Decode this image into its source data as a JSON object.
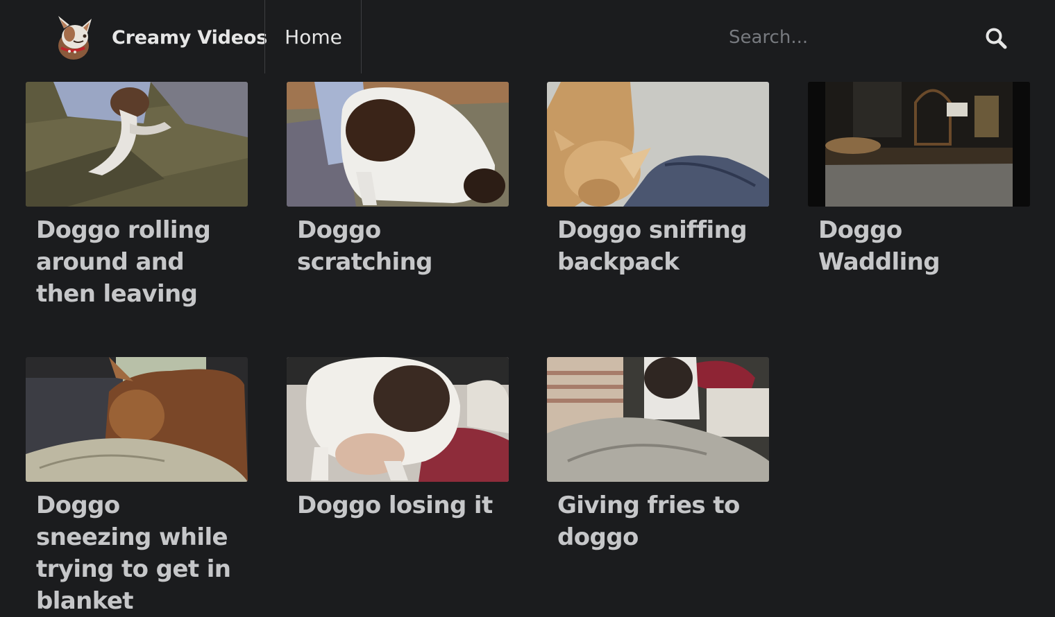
{
  "brand": {
    "name": "Creamy Videos"
  },
  "nav": {
    "home_label": "Home"
  },
  "search": {
    "placeholder": "Search..."
  },
  "videos": [
    {
      "title": "Doggo rolling around and then leaving"
    },
    {
      "title": "Doggo scratching"
    },
    {
      "title": "Doggo sniffing backpack"
    },
    {
      "title": "Doggo Waddling"
    },
    {
      "title": "Doggo sneezing while trying to get in blanket"
    },
    {
      "title": "Doggo losing it"
    },
    {
      "title": "Giving fries to doggo"
    }
  ]
}
